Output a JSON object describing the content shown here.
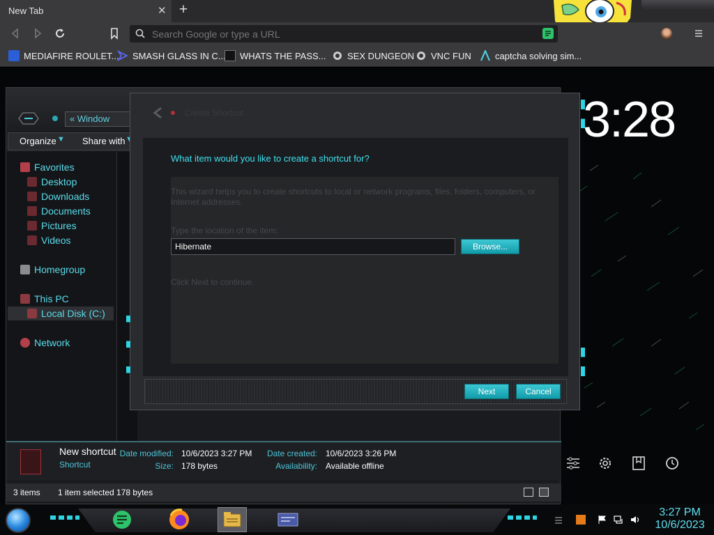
{
  "browser": {
    "tab": {
      "title": "New Tab",
      "close": "✕"
    },
    "new_tab": "+",
    "url_placeholder": "Search Google or type a URL",
    "bookmarks": [
      {
        "label": "MEDIAFIRE ROULET...",
        "icon": "mediafire-icon"
      },
      {
        "label": "SMASH GLASS IN C...",
        "icon": "bookmark-site-icon"
      },
      {
        "label": "WHATS THE PASS...",
        "icon": "bookmark-site-icon"
      },
      {
        "label": "SEX DUNGEON",
        "icon": "bookmark-site-icon"
      },
      {
        "label": "VNC FUN",
        "icon": "bookmark-site-icon"
      },
      {
        "label": "captcha solving sim...",
        "icon": "bookmark-site-icon"
      }
    ]
  },
  "desktop": {
    "clock_big": "3:28"
  },
  "explorer": {
    "address": "«  Window",
    "commands": {
      "organize": "Organize",
      "share": "Share with"
    },
    "nav": {
      "favorites": "Favorites",
      "desktop": "Desktop",
      "downloads": "Downloads",
      "documents": "Documents",
      "pictures": "Pictures",
      "videos": "Videos",
      "homegroup": "Homegroup",
      "this_pc": "This PC",
      "local_disk": "Local Disk (C:)",
      "network": "Network"
    },
    "details": {
      "name": "New shortcut",
      "type": "Shortcut",
      "date_modified_label": "Date modified:",
      "date_modified": "10/6/2023 3:27 PM",
      "size_label": "Size:",
      "size": "178 bytes",
      "date_created_label": "Date created:",
      "date_created": "10/6/2023 3:26 PM",
      "availability_label": "Availability:",
      "availability": "Available offline"
    },
    "status": {
      "items": "3 items",
      "selected": "1 item selected  178 bytes"
    }
  },
  "wizard": {
    "title": "Create Shortcut",
    "question": "What item would you like to create a shortcut for?",
    "description": "This wizard helps you to create shortcuts to local or network programs, files, folders, computers, or Internet addresses.",
    "location_label": "Type the location of the item:",
    "location_value": "Hibernate",
    "browse": "Browse...",
    "continue_text": "Click Next to continue.",
    "next": "Next",
    "cancel": "Cancel"
  },
  "taskbar": {
    "time": "3:27 PM",
    "date": "10/6/2023"
  },
  "colors": {
    "accent": "#40e0f0",
    "button": "#1aa9b6"
  }
}
